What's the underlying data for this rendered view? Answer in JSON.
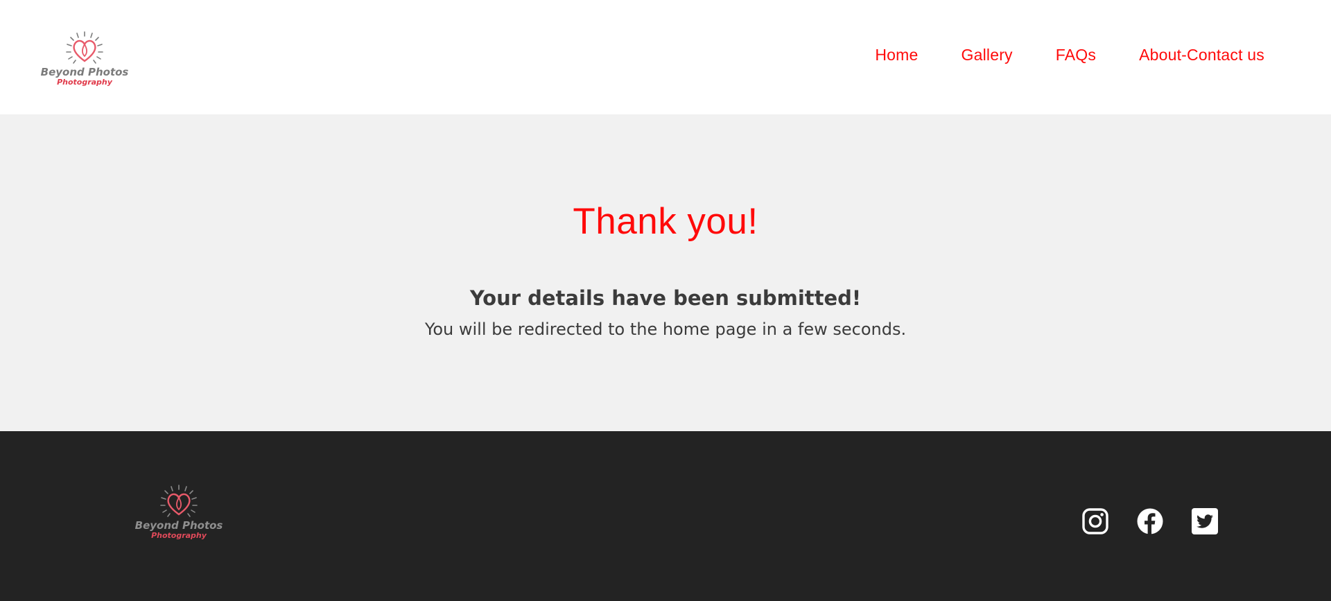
{
  "brand": {
    "name_line1": "Beyond Photos",
    "name_line2": "Photography",
    "colors": {
      "accent": "#ff0a0a",
      "logo_heart": "#e85a6a",
      "logo_text_gray": "#7b7b7b",
      "logo_text_red": "#e03a4a"
    }
  },
  "nav": {
    "items": [
      {
        "label": "Home"
      },
      {
        "label": "Gallery"
      },
      {
        "label": "FAQs"
      },
      {
        "label": "About-Contact us"
      }
    ]
  },
  "main": {
    "heading": "Thank you!",
    "subheading": "Your details have been submitted!",
    "message": "You will be redirected to the home page in a few seconds."
  },
  "footer": {
    "social": [
      {
        "icon": "instagram-icon"
      },
      {
        "icon": "facebook-icon"
      },
      {
        "icon": "twitter-icon"
      }
    ]
  },
  "colors": {
    "header_bg": "#ffffff",
    "main_bg": "#f1f1f1",
    "footer_bg": "#232323",
    "body_text": "#3b3b3b"
  }
}
